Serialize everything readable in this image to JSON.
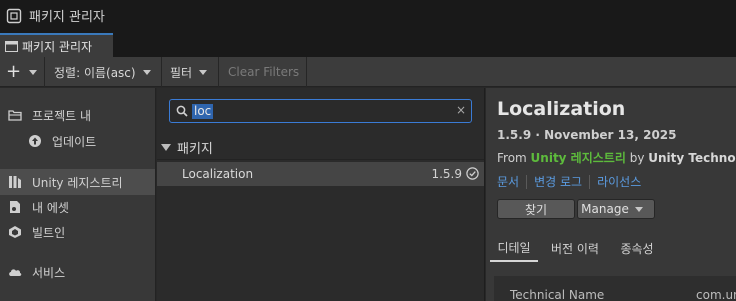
{
  "window": {
    "title": "패키지 관리자"
  },
  "tab": {
    "label": "패키지 관리자"
  },
  "toolbar": {
    "add_label": "+",
    "sort_label": "정렬: 이름(asc)",
    "filter_label": "필터",
    "clear_filters_label": "Clear Filters"
  },
  "sidebar": {
    "items": [
      {
        "label": "프로젝트 내",
        "icon": "folder-icon"
      },
      {
        "label": "업데이트",
        "icon": "update-arrow-icon"
      },
      {
        "label": "Unity 레지스트리",
        "icon": "unity-registry-icon",
        "selected": true
      },
      {
        "label": "내 에셋",
        "icon": "my-assets-icon"
      },
      {
        "label": "빌트인",
        "icon": "unity-builtin-icon"
      },
      {
        "label": "서비스",
        "icon": "cloud-icon"
      }
    ]
  },
  "search": {
    "value": "loc",
    "clear_label": "×"
  },
  "package_list": {
    "group_label": "패키지",
    "packages": [
      {
        "name": "Localization",
        "version": "1.5.9",
        "installed": true
      }
    ]
  },
  "details": {
    "title": "Localization",
    "version_line": "1.5.9 · November 13, 2025",
    "from_prefix": "From ",
    "source": "Unity 레지스트리",
    "by_label": " by ",
    "author": "Unity Technologies",
    "links": [
      "문서",
      "변경 로그",
      "라이선스"
    ],
    "find_button": "찾기",
    "manage_button": "Manage",
    "tabs": [
      "디테일",
      "버전 이력",
      "종속성"
    ],
    "technical_name_label": "Technical Name",
    "technical_name_value": "com.unity.localization"
  },
  "colors": {
    "accent_blue": "#3a7bd5",
    "link_blue": "#5b9be0",
    "registry_green": "#5dbb3c",
    "selection": "#2f65ae"
  }
}
